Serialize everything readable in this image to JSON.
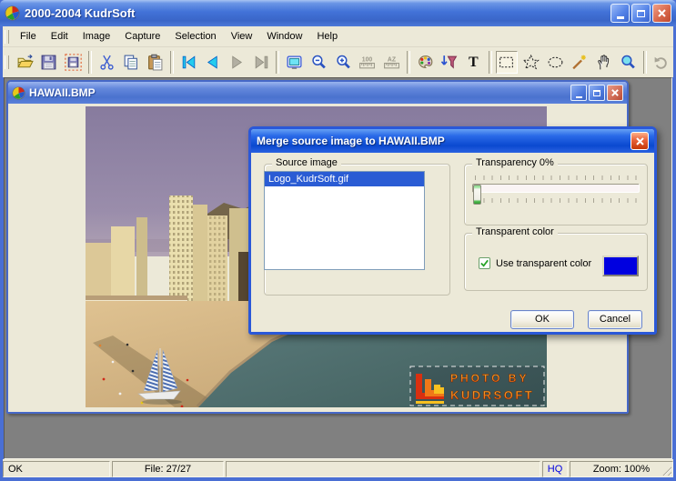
{
  "window": {
    "title": "2000-2004 KudrSoft"
  },
  "menu": {
    "items": [
      "File",
      "Edit",
      "Image",
      "Capture",
      "Selection",
      "View",
      "Window",
      "Help"
    ]
  },
  "toolbar": {
    "icons": [
      "open",
      "save",
      "save-frame",
      "cut",
      "copy",
      "paste",
      "first",
      "previous",
      "next",
      "last",
      "screen-capture",
      "zoom-out",
      "zoom-in",
      "ruler-100",
      "ruler-az",
      "palette",
      "filter",
      "text",
      "select-rectangle",
      "select-polygon",
      "select-ellipse",
      "magic-wand",
      "pan-hand",
      "zoom-tool",
      "undo"
    ],
    "disabled_icons": [
      "next",
      "last",
      "ruler-100",
      "ruler-az",
      "undo"
    ],
    "active_icon": "select-rectangle",
    "text_tool_glyph": "T",
    "ruler100_glyph": "100",
    "rulerAZ_glyph": "AZ"
  },
  "child_window": {
    "title": "HAWAII.BMP"
  },
  "dialog": {
    "title": "Merge source image to HAWAII.BMP",
    "source_group_label": "Source image",
    "source_list": [
      {
        "label": "Logo_KudrSoft.gif",
        "selected": true
      }
    ],
    "transparency_group_label": "Transparency 0%",
    "transparency_value": 0,
    "transparent_color_group_label": "Transparent color",
    "use_transparent_color_label": "Use transparent color",
    "use_transparent_color_checked": true,
    "transparent_color_value": "#0000e0",
    "ok_label": "OK",
    "cancel_label": "Cancel"
  },
  "photo": {
    "watermark_line1": "PHOTO BY",
    "watermark_line2": "KUDRSOFT"
  },
  "statusbar": {
    "status": "OK",
    "file_counter": "File: 27/27",
    "quality": "HQ",
    "zoom": "Zoom: 100%"
  },
  "colors": {
    "selection_blue": "#2a5cd4",
    "swatch_blue": "#0000e0",
    "mdi_gray": "#808080",
    "face": "#ece9d8"
  }
}
